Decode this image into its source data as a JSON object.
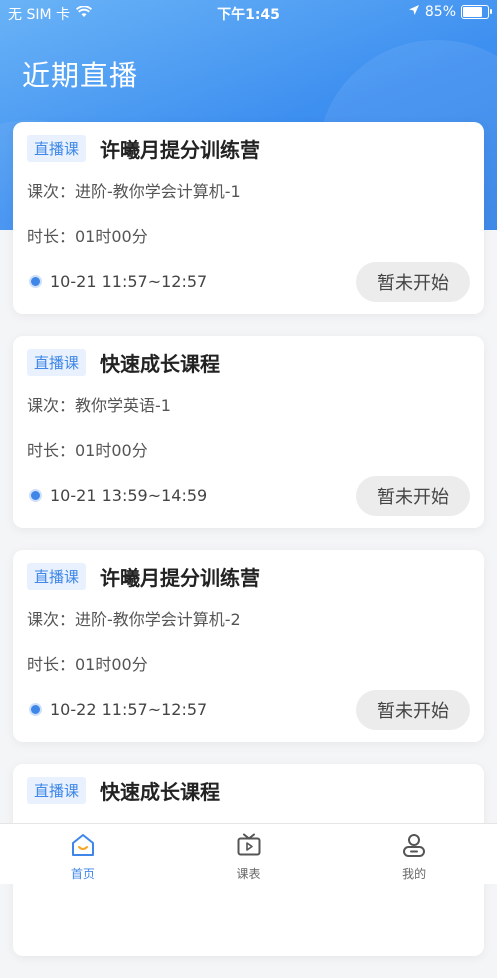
{
  "status_bar": {
    "carrier": "无 SIM 卡",
    "time": "下午1:45",
    "battery": "85%",
    "battery_level": 0.85
  },
  "header": {
    "title": "近期直播"
  },
  "colors": {
    "accent": "#3e86e8",
    "header": "#3d8ff0"
  },
  "cards": [
    {
      "tag": "直播课",
      "title": "许曦月提分训练营",
      "session": "课次：进阶-教你学会计算机-1",
      "duration": "时长：01时00分",
      "time": "10-21 11:57~12:57",
      "status": "暂未开始"
    },
    {
      "tag": "直播课",
      "title": "快速成长课程",
      "session": "课次：教你学英语-1",
      "duration": "时长：01时00分",
      "time": "10-21 13:59~14:59",
      "status": "暂未开始"
    },
    {
      "tag": "直播课",
      "title": "许曦月提分训练营",
      "session": "课次：进阶-教你学会计算机-2",
      "duration": "时长：01时00分",
      "time": "10-22 11:57~12:57",
      "status": "暂未开始"
    },
    {
      "tag": "直播课",
      "title": "快速成长课程",
      "session": "",
      "duration": "",
      "time": "",
      "status": ""
    }
  ],
  "tabbar": {
    "items": [
      {
        "label": "首页",
        "icon": "home-icon",
        "active": true
      },
      {
        "label": "课表",
        "icon": "tv-icon",
        "active": false
      },
      {
        "label": "我的",
        "icon": "user-icon",
        "active": false
      }
    ]
  }
}
